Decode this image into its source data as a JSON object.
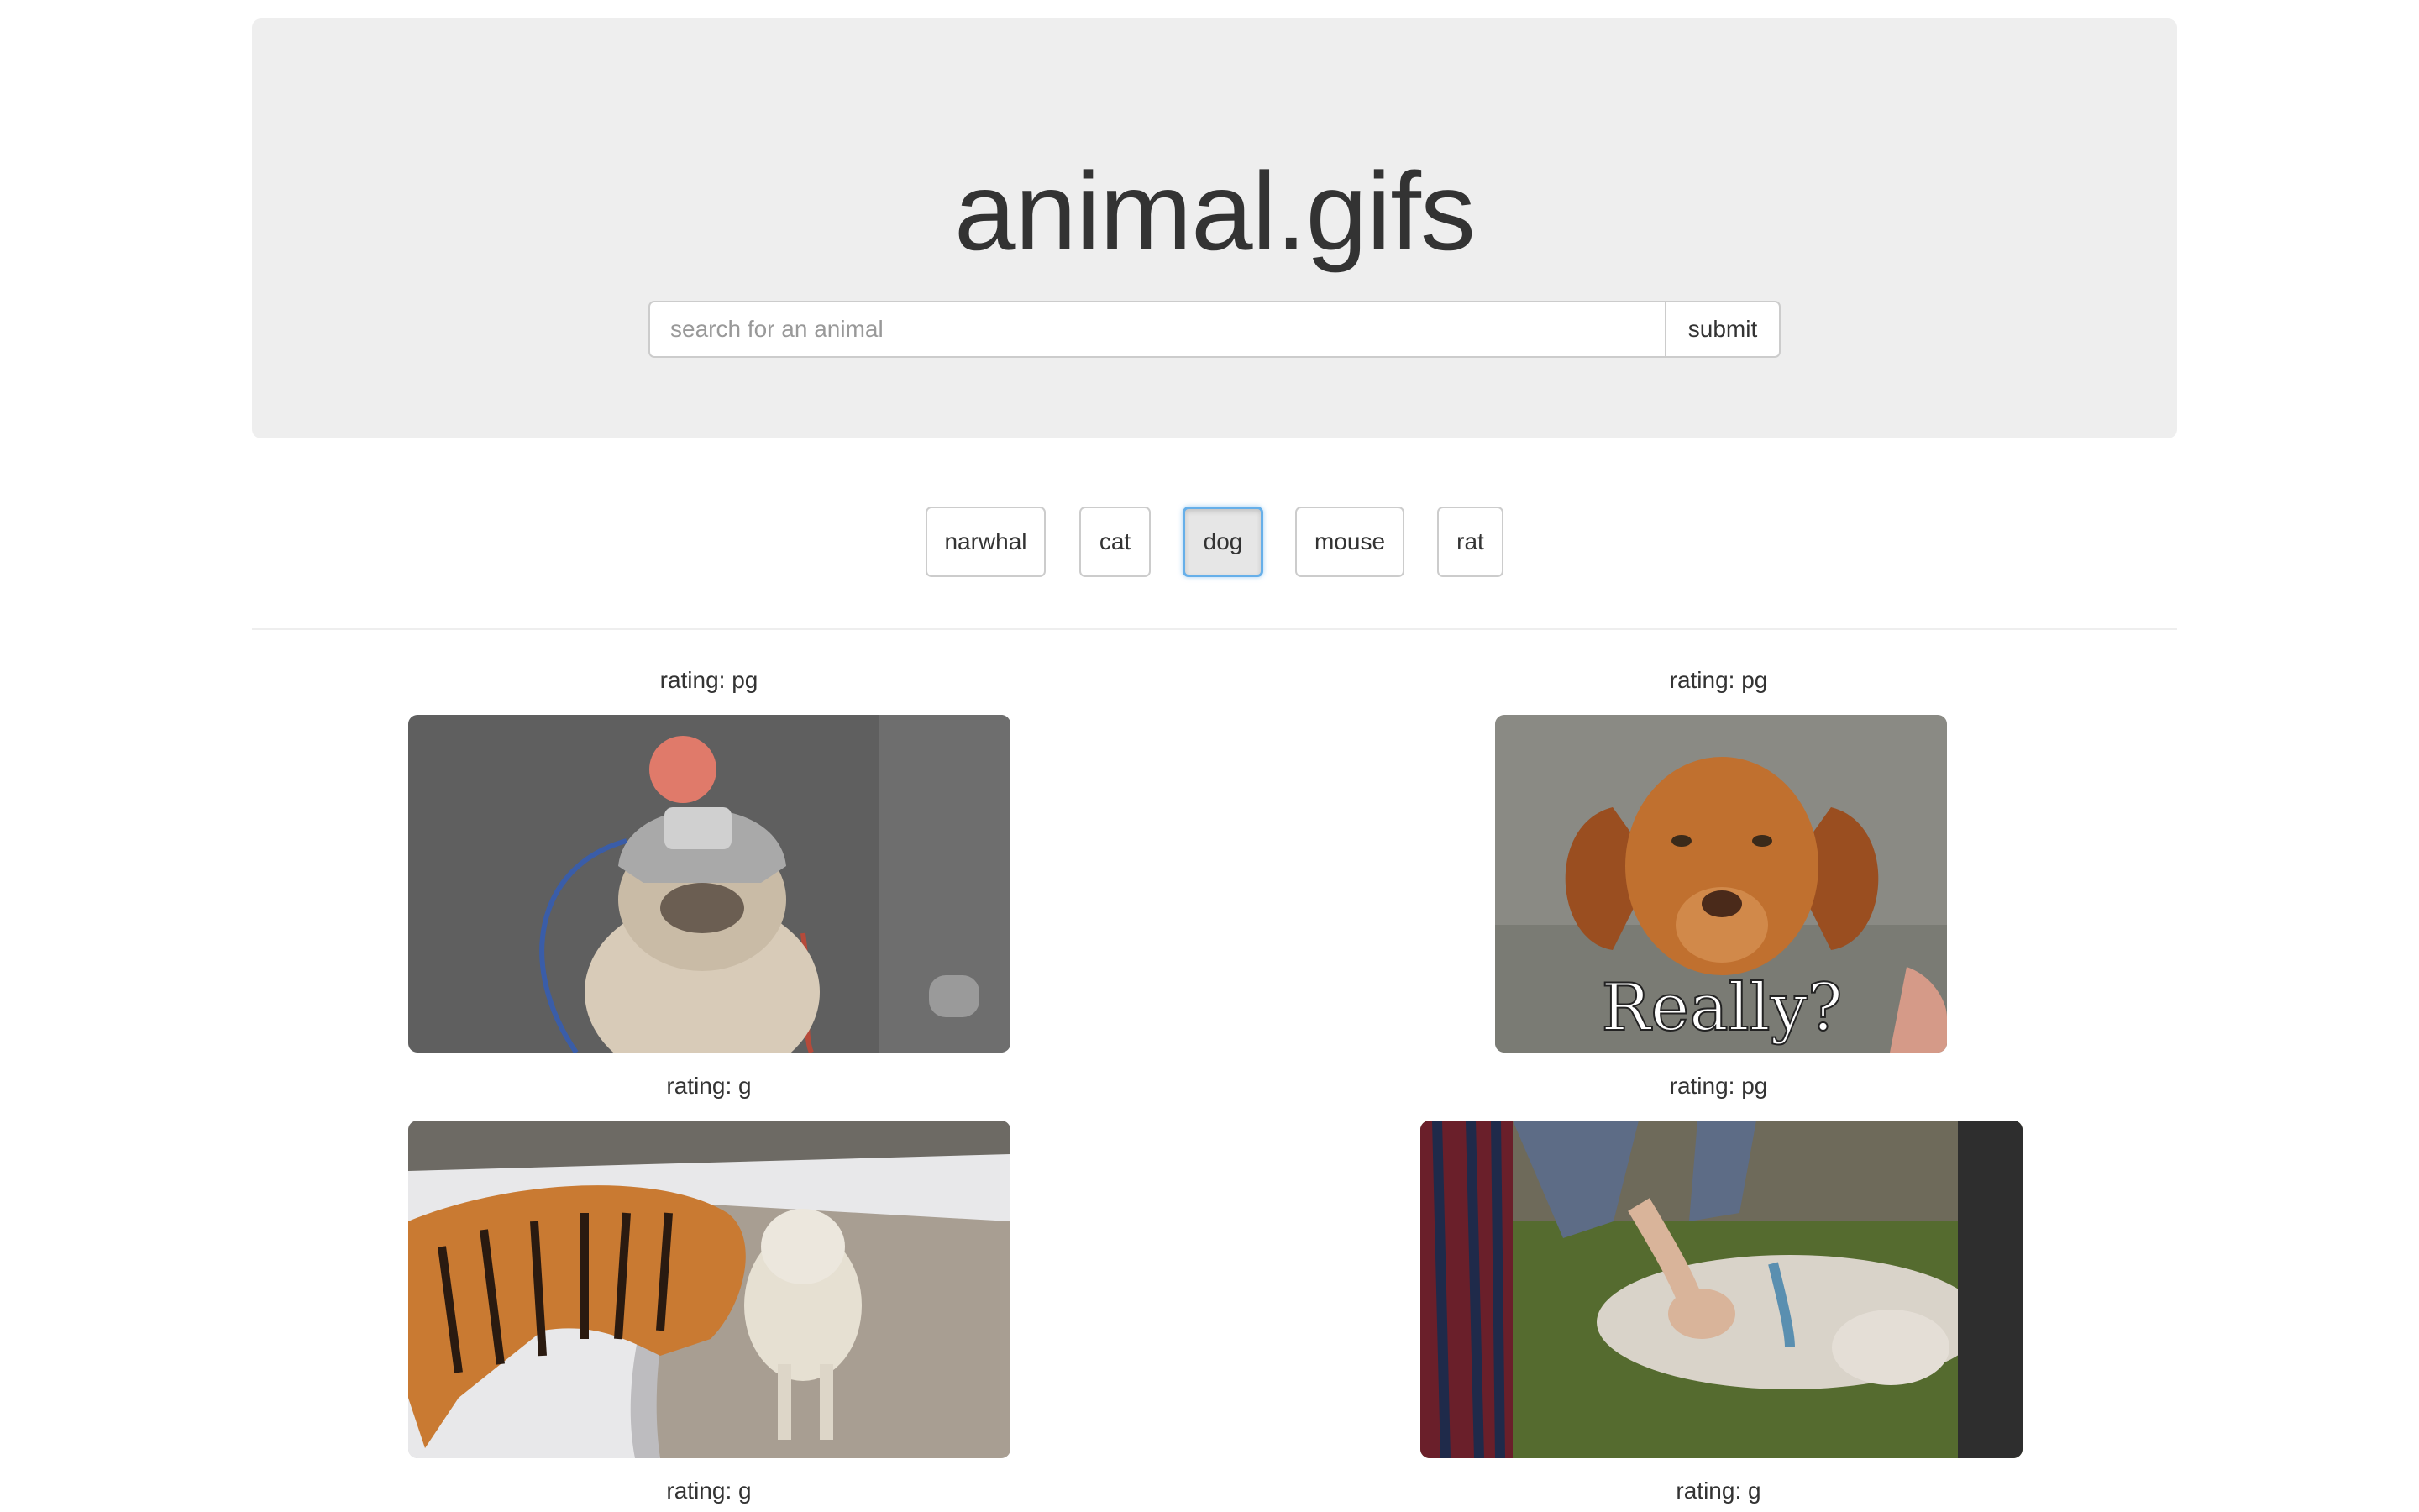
{
  "header": {
    "title": "animal.gifs"
  },
  "search": {
    "placeholder": "search for an animal",
    "value": "",
    "submit_label": "submit"
  },
  "filters": [
    {
      "label": "narwhal",
      "active": false
    },
    {
      "label": "cat",
      "active": false
    },
    {
      "label": "dog",
      "active": true
    },
    {
      "label": "mouse",
      "active": false
    },
    {
      "label": "rat",
      "active": false
    }
  ],
  "results": [
    {
      "rating": "rating: pg",
      "subject": "bulldog-in-helmet"
    },
    {
      "rating": "rating: pg",
      "subject": "puppy-really",
      "caption": "Really?"
    },
    {
      "rating": "rating: g",
      "subject": "tiger-and-dog-in-snow"
    },
    {
      "rating": "rating: pg",
      "subject": "dog-belly-rub"
    },
    {
      "rating": "rating: g"
    },
    {
      "rating": "rating: g"
    }
  ]
}
